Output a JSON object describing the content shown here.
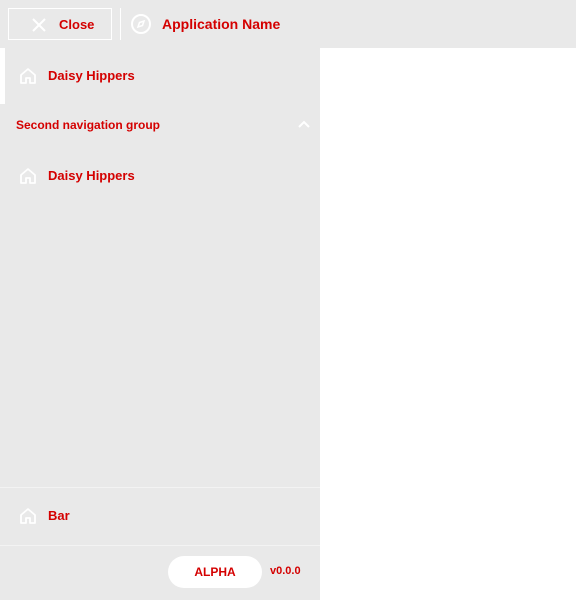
{
  "header": {
    "close_label": "Close",
    "app_name": "Application Name"
  },
  "sidebar": {
    "items": [
      {
        "label": "Daisy Hippers",
        "icon": "home-icon"
      }
    ],
    "group": {
      "label": "Second navigation group",
      "icon": "chevron-up-icon",
      "items": [
        {
          "label": "Daisy Hippers",
          "icon": "home-icon"
        }
      ]
    },
    "footer_items": [
      {
        "label": "Bar",
        "icon": "home-icon"
      }
    ],
    "badge": "ALPHA",
    "version": "v0.0.0"
  },
  "colors": {
    "accent": "#d40000",
    "background": "#e9e9e9",
    "main": "#ffffff"
  }
}
